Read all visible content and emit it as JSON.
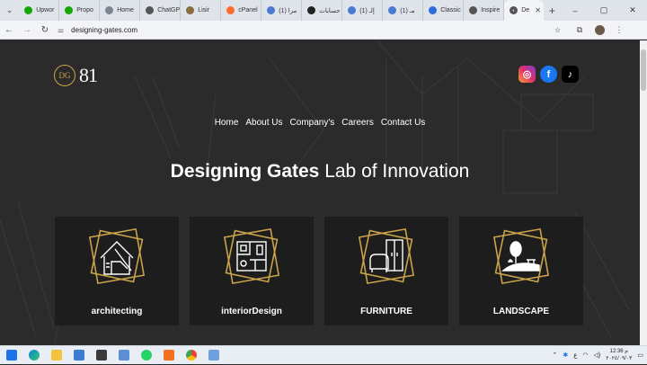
{
  "browser": {
    "tabs": [
      {
        "label": "Upwor",
        "color": "#14a800"
      },
      {
        "label": "Propo",
        "color": "#14a800"
      },
      {
        "label": "Home",
        "color": "#7d8590"
      },
      {
        "label": "ChatGP",
        "color": "#555555"
      },
      {
        "label": "Lisir",
        "color": "#8a6d3b"
      },
      {
        "label": "cPanel",
        "color": "#ff6c2c"
      },
      {
        "label": "(1) مرا",
        "color": "#4a7bd0"
      },
      {
        "label": "حسابات",
        "color": "#222222"
      },
      {
        "label": "(1) إلـ",
        "color": "#4a7bd0"
      },
      {
        "label": "(1) مـ",
        "color": "#4a7bd0"
      },
      {
        "label": "Classic",
        "color": "#2d6cdf"
      },
      {
        "label": "Inspire",
        "color": "#555555"
      }
    ],
    "active_tab": {
      "label": "De"
    },
    "new_tab_symbol": "+",
    "url": "designing-gates.com",
    "window_controls": [
      "‒",
      "▢",
      "✕"
    ]
  },
  "site": {
    "logo_initials": "DG",
    "logo_number": "81",
    "nav": [
      "Home",
      "About Us",
      "Company's",
      "Careers",
      "Contact Us"
    ],
    "headline_bold": "Designing Gates",
    "headline_rest": " Lab of Innovation",
    "cards": [
      {
        "label": "architecting",
        "icon": "architecture-icon"
      },
      {
        "label": "interiorDesign",
        "icon": "floorplan-icon"
      },
      {
        "label": "FURNITURE",
        "icon": "furniture-icon"
      },
      {
        "label": "LANDSCAPE",
        "icon": "landscape-icon"
      }
    ],
    "socials": [
      "instagram-icon",
      "facebook-icon",
      "tiktok-icon"
    ],
    "accent_color": "#c9a24a"
  },
  "taskbar": {
    "lang": "ع",
    "time": "12:36 م",
    "date": "٢٠٢٤/٠٩/٠٣"
  }
}
